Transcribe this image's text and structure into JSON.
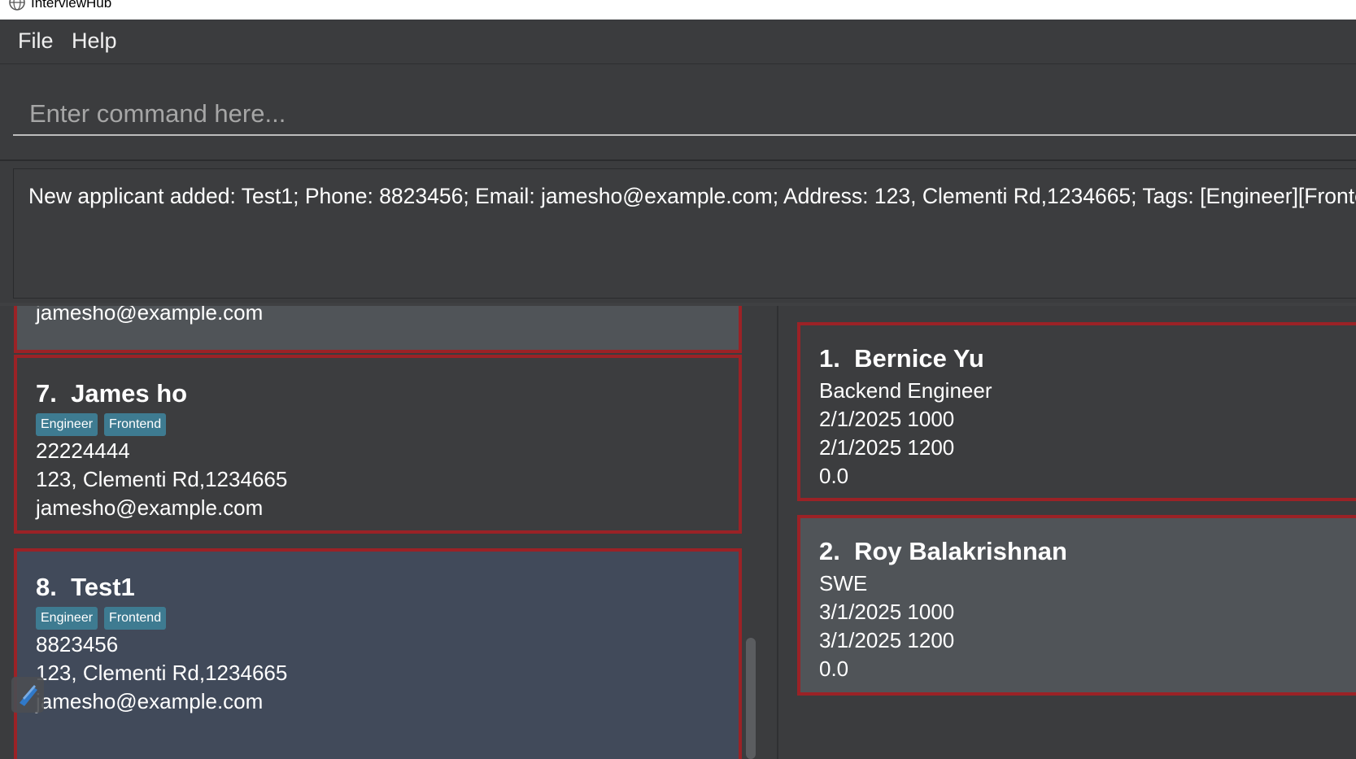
{
  "window": {
    "title": "InterviewHub"
  },
  "menu": {
    "items": [
      "File",
      "Help"
    ]
  },
  "command": {
    "placeholder": "Enter command here...",
    "value": ""
  },
  "result": {
    "text": "New applicant added: Test1; Phone: 8823456; Email: jamesho@example.com; Address: 123, Clementi Rd,1234665; Tags: [Engineer][Frontend]"
  },
  "applicants": [
    {
      "email": "jamesho@example.com"
    },
    {
      "index": "7.",
      "name": "James ho",
      "tags": [
        "Engineer",
        "Frontend"
      ],
      "phone": "22224444",
      "address": "123, Clementi Rd,1234665",
      "email": "jamesho@example.com"
    },
    {
      "index": "8.",
      "name": "Test1",
      "tags": [
        "Engineer",
        "Frontend"
      ],
      "phone": "8823456",
      "address": "123, Clementi Rd,1234665",
      "email": "jamesho@example.com"
    }
  ],
  "interviews": [
    {
      "index": "1.",
      "name": "Bernice Yu",
      "role": "Backend Engineer",
      "start": "2/1/2025 1000",
      "end": "2/1/2025 1200",
      "rating": "0.0"
    },
    {
      "index": "2.",
      "name": "Roy Balakrishnan",
      "role": "SWE",
      "start": "3/1/2025 1000",
      "end": "3/1/2025 1200",
      "rating": "0.0"
    }
  ],
  "colors": {
    "background": "#3b3c3e",
    "card_border": "#9b2226",
    "tag": "#3e7b91",
    "selected_card": "#414a5a",
    "alt_card": "#505458"
  },
  "icons": [
    "globe-icon",
    "floating-tool-icon"
  ]
}
